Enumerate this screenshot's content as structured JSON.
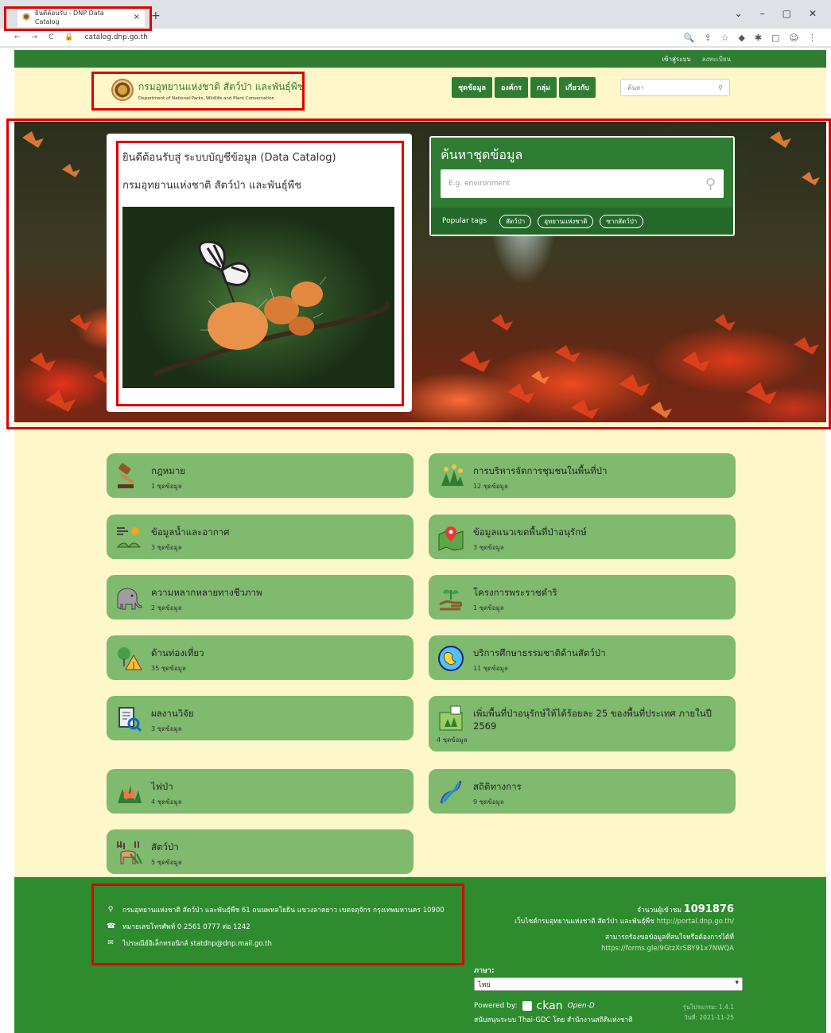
{
  "browser": {
    "tab_title": "ยินดีต้อนรับ - DNP Data Catalog",
    "tab_close": "×",
    "new_tab": "+",
    "url": "catalog.dnp.go.th",
    "nav_back": "←",
    "nav_forward": "→",
    "nav_reload": "C",
    "win_controls": [
      "⌄",
      "–",
      "▢",
      "✕"
    ]
  },
  "topbar": {
    "login": "เข้าสู่ระบบ",
    "register": "ลงทะเบียน"
  },
  "header": {
    "org_name_th": "กรมอุทยานแห่งชาติ สัตว์ป่า และพันธุ์พืช",
    "org_name_en": "Department of National Parks, Wildlife and Plant Conservation",
    "nav": [
      "ชุดข้อมูล",
      "องค์กร",
      "กลุ่ม",
      "เกี่ยวกับ"
    ],
    "search_placeholder": "ค้นหา"
  },
  "hero": {
    "welcome_line1": "ยินดีต้อนรับสู่ ระบบบัญชีข้อมูล (Data Catalog)",
    "welcome_line2": "กรมอุทยานแห่งชาติ สัตว์ป่า และพันธุ์พืช",
    "search_title": "ค้นหาชุดข้อมูล",
    "search_placeholder": "E.g. environment",
    "popular_tags_label": "Popular tags",
    "tags": [
      "สัตว์ป่า",
      "อุทยานแห่งชาติ",
      "ซากสัตว์ป่า"
    ]
  },
  "groups": [
    {
      "title": "กฎหมาย",
      "count": "1 ชุดข้อมูล",
      "icon": "gavel-icon"
    },
    {
      "title": "การบริหารจัดการชุมชนในพื้นที่ป่า",
      "count": "12 ชุดข้อมูล",
      "icon": "community-forest-icon"
    },
    {
      "title": "ข้อมูลน้ำและอากาศ",
      "count": "3 ชุดข้อมูล",
      "icon": "weather-icon"
    },
    {
      "title": "ข้อมูลแนวเขตพื้นที่ป่าอนุรักษ์",
      "count": "3 ชุดข้อมูล",
      "icon": "map-pin-icon"
    },
    {
      "title": "ความหลากหลายทางชีวภาพ",
      "count": "2 ชุดข้อมูล",
      "icon": "elephant-icon"
    },
    {
      "title": "โครงการพระราชดำริ",
      "count": "1 ชุดข้อมูล",
      "icon": "plant-hand-icon"
    },
    {
      "title": "ด้านท่องเที่ยว",
      "count": "35 ชุดข้อมูล",
      "icon": "tent-icon"
    },
    {
      "title": "บริการศึกษาธรรมชาติด้านสัตว์ป่า",
      "count": "11 ชุดข้อมูล",
      "icon": "globe-icon"
    },
    {
      "title": "ผลงานวิจัย",
      "count": "3 ชุดข้อมูล",
      "icon": "research-icon"
    },
    {
      "title": "เพิ่มพื้นที่ป่าอนุรักษ์ให้ได้ร้อยละ 25 ของพื้นที่ประเทศ ภายในปี 2569",
      "count": "4 ชุดข้อมูล",
      "icon": "forest-map-icon"
    },
    {
      "title": "ไฟป่า",
      "count": "4 ชุดข้อมูล",
      "icon": "forest-fire-icon"
    },
    {
      "title": "สถิติทางการ",
      "count": "9 ชุดข้อมูล",
      "icon": "statistics-icon"
    },
    {
      "title": "สัตว์ป่า",
      "count": "5 ชุดข้อมูล",
      "icon": "deer-icon"
    }
  ],
  "footer": {
    "address": "กรมอุทยานแห่งชาติ สัตว์ป่า และพันธุ์พืช 61 ถนนพหลโยธิน แขวงลาดยาว เขตจตุจักร กรุงเทพมหานคร 10900",
    "phone": "หมายเลขโทรศัพท์ 0 2561 0777 ต่อ 1242",
    "email": "ไปรษณีย์อิเล็กทรอนิกส์ statdnp@dnp.mail.go.th",
    "visitors_label": "จำนวนผู้เข้าชม",
    "visitors": "1091876",
    "website_label": "เว็บไซต์กรมอุทยานแห่งชาติ สัตว์ป่า และพันธุ์พืช",
    "website_url": "http://portal.dnp.go.th/",
    "request_label": "สามารถร้องขอข้อมูลที่สนใจหรือต้องการได้ที่",
    "request_url": "https://forms.gle/9GtzXrSBY91x7NWQA",
    "language_label": "ภาษา:",
    "language_value": "ไทย",
    "powered_by": "Powered by:",
    "ckan": "ckan",
    "open_d": "Open-D",
    "support": "สนับสนุนระบบ Thai-GDC โดย สำนักงานสถิติแห่งชาติ",
    "version": "รุ่นโปรแกรม: 1.4.1",
    "date": "วันที่: 2021-11-25"
  },
  "colors": {
    "brand_green": "#2e7d32",
    "group_green": "#7fba6e",
    "background": "#fdf7c9",
    "highlight_red": "#e00000"
  }
}
